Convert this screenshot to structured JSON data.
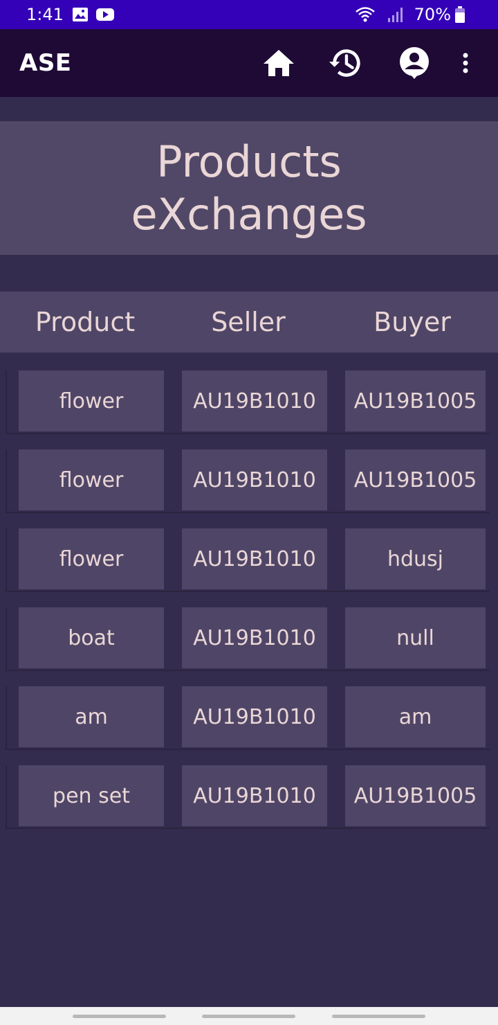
{
  "status_bar": {
    "time": "1:41",
    "battery": "70%"
  },
  "app_bar": {
    "title": "ASE",
    "icons": [
      "home-icon",
      "history-icon",
      "account-icon",
      "more-vert-icon"
    ]
  },
  "hero": {
    "line1": "Products",
    "line2": "eXchanges"
  },
  "table": {
    "headers": [
      "Product",
      "Seller",
      "Buyer"
    ],
    "rows": [
      [
        "flower",
        "AU19B1010",
        "AU19B1005"
      ],
      [
        "flower",
        "AU19B1010",
        "AU19B1005"
      ],
      [
        "flower",
        "AU19B1010",
        "hdusj"
      ],
      [
        "boat",
        "AU19B1010",
        "null"
      ],
      [
        "am",
        "AU19B1010",
        "am"
      ],
      [
        "pen set",
        "AU19B1010",
        "AU19B1005"
      ]
    ]
  },
  "colors": {
    "status_bar": "#3400b8",
    "app_bar": "#1f0a36",
    "background": "#342c4e",
    "panel": "#4f4667",
    "text": "#ead6d6"
  }
}
